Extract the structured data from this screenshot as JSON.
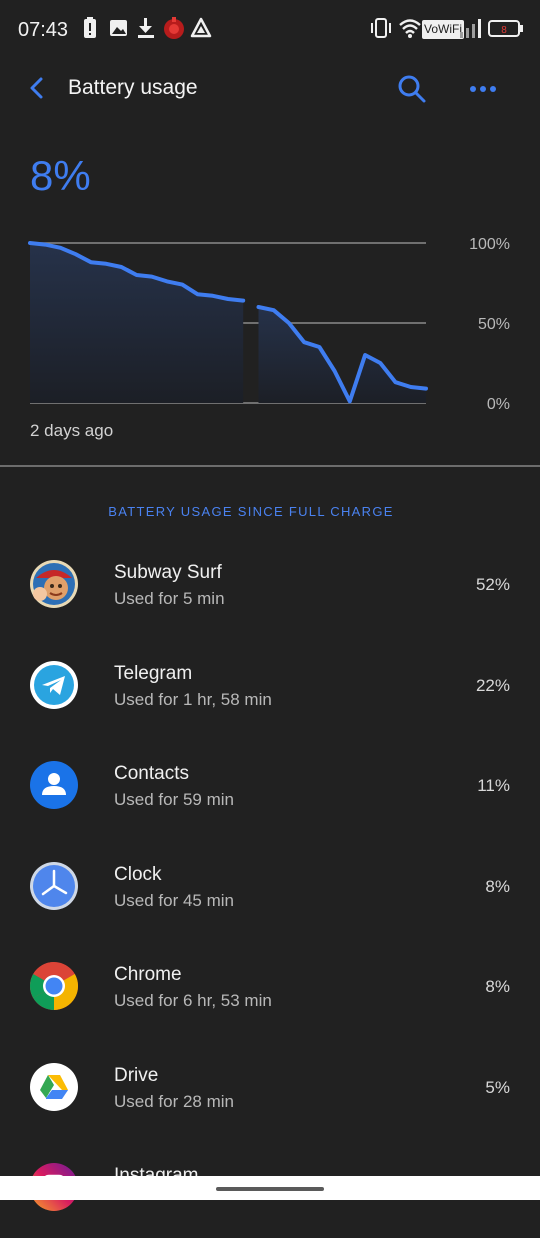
{
  "status_bar": {
    "time": "07:43",
    "wifi_label": "VoWiFi",
    "battery_level": "8"
  },
  "app_bar": {
    "title": "Battery usage"
  },
  "battery": {
    "percent": "8%",
    "since_label": "2 days ago"
  },
  "chart_data": {
    "type": "area",
    "ylim": [
      0,
      100
    ],
    "yticks": [
      "100%",
      "50%",
      "0%"
    ],
    "xlabel": "",
    "ylabel": "",
    "grid": true,
    "series": [
      {
        "values": [
          100,
          99,
          97,
          93,
          88,
          87,
          85,
          80,
          79,
          76,
          74,
          68,
          67,
          65,
          64,
          60,
          58,
          50,
          38,
          35,
          20,
          1,
          30,
          25,
          13,
          10,
          9
        ]
      }
    ],
    "segments": [
      [
        0,
        14
      ],
      [
        15,
        26
      ]
    ]
  },
  "section_header": "BATTERY USAGE SINCE FULL CHARGE",
  "apps": [
    {
      "name": "Subway Surf",
      "usage": "Used for 5 min",
      "percent": "52%",
      "icon": "subway-surf-icon"
    },
    {
      "name": "Telegram",
      "usage": "Used for 1 hr, 58 min",
      "percent": "22%",
      "icon": "telegram-icon"
    },
    {
      "name": "Contacts",
      "usage": "Used for 59 min",
      "percent": "11%",
      "icon": "contacts-icon"
    },
    {
      "name": "Clock",
      "usage": "Used for 45 min",
      "percent": "8%",
      "icon": "clock-icon"
    },
    {
      "name": "Chrome",
      "usage": "Used for 6 hr, 53 min",
      "percent": "8%",
      "icon": "chrome-icon"
    },
    {
      "name": "Drive",
      "usage": "Used for 28 min",
      "percent": "5%",
      "icon": "drive-icon"
    },
    {
      "name": "Instagram",
      "usage": "",
      "percent": "",
      "icon": "instagram-icon"
    }
  ],
  "colors": {
    "accent": "#3f7df0",
    "background": "#212121",
    "battery_low": "#e53935"
  }
}
